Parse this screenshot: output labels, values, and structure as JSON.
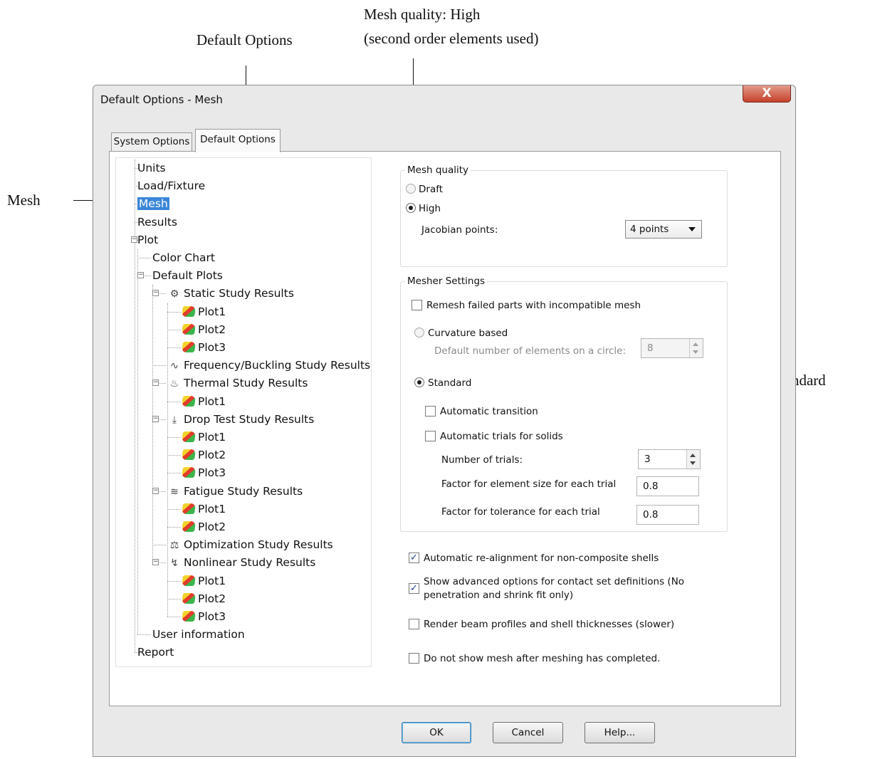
{
  "annotations": {
    "default_options": "Default Options",
    "mesh_quality_line1": "Mesh quality: High",
    "mesh_quality_line2": "(second order elements used)",
    "mesh": "Mesh",
    "mesh_type": "Mesh type: Standard"
  },
  "dialog": {
    "title": "Default Options - Mesh",
    "close_label": "X",
    "tabs": [
      {
        "label": "System Options",
        "active": false
      },
      {
        "label": "Default Options",
        "active": true
      }
    ]
  },
  "tree": {
    "selected": "Mesh",
    "items": [
      {
        "label": "Units",
        "level": 0
      },
      {
        "label": "Load/Fixture",
        "level": 0
      },
      {
        "label": "Mesh",
        "level": 0
      },
      {
        "label": "Results",
        "level": 0
      },
      {
        "label": "Plot",
        "level": 0
      },
      {
        "label": "Color Chart",
        "level": 1
      },
      {
        "label": "Default Plots",
        "level": 1
      },
      {
        "label": "Static Study Results",
        "level": 2
      },
      {
        "label": "Plot1",
        "level": 3
      },
      {
        "label": "Plot2",
        "level": 3
      },
      {
        "label": "Plot3",
        "level": 3
      },
      {
        "label": "Frequency/Buckling Study Results",
        "level": 2
      },
      {
        "label": "Thermal Study Results",
        "level": 2
      },
      {
        "label": "Plot1",
        "level": 3
      },
      {
        "label": "Drop Test Study Results",
        "level": 2
      },
      {
        "label": "Plot1",
        "level": 3
      },
      {
        "label": "Plot2",
        "level": 3
      },
      {
        "label": "Plot3",
        "level": 3
      },
      {
        "label": "Fatigue Study Results",
        "level": 2
      },
      {
        "label": "Plot1",
        "level": 3
      },
      {
        "label": "Plot2",
        "level": 3
      },
      {
        "label": "Optimization Study Results",
        "level": 2
      },
      {
        "label": "Nonlinear Study Results",
        "level": 2
      },
      {
        "label": "Plot1",
        "level": 3
      },
      {
        "label": "Plot2",
        "level": 3
      },
      {
        "label": "Plot3",
        "level": 3
      },
      {
        "label": "User information",
        "level": 1
      },
      {
        "label": "Report",
        "level": 0
      }
    ]
  },
  "mesh_quality": {
    "group_label": "Mesh quality",
    "draft_label": "Draft",
    "high_label": "High",
    "selected": "High",
    "jacobian_label": "Jacobian points:",
    "jacobian_value": "4 points"
  },
  "mesher_settings": {
    "group_label": "Mesher Settings",
    "remesh_label": "Remesh failed parts with incompatible mesh",
    "remesh_checked": false,
    "curvature_label": "Curvature based",
    "elements_on_circle_label": "Default number of elements on a circle:",
    "elements_on_circle_value": "8",
    "standard_label": "Standard",
    "selected": "Standard",
    "auto_transition_label": "Automatic transition",
    "auto_transition_checked": false,
    "auto_trials_label": "Automatic trials for solids",
    "auto_trials_checked": false,
    "num_trials_label": "Number of trials:",
    "num_trials_value": "3",
    "factor_size_label": "Factor for element size for each trial",
    "factor_size_value": "0.8",
    "factor_tol_label": "Factor for tolerance for each trial",
    "factor_tol_value": "0.8"
  },
  "options": {
    "realign_label": "Automatic re-alignment for non-composite shells",
    "realign_checked": true,
    "advanced_line1": "Show advanced options for contact set definitions (No",
    "advanced_line2": "penetration and shrink fit only)",
    "advanced_checked": true,
    "render_label": "Render beam profiles and shell thicknesses (slower)",
    "render_checked": false,
    "hide_mesh_label": "Do not show mesh after meshing has completed.",
    "hide_mesh_checked": false
  },
  "buttons": {
    "ok": "OK",
    "cancel": "Cancel",
    "help": "Help..."
  }
}
